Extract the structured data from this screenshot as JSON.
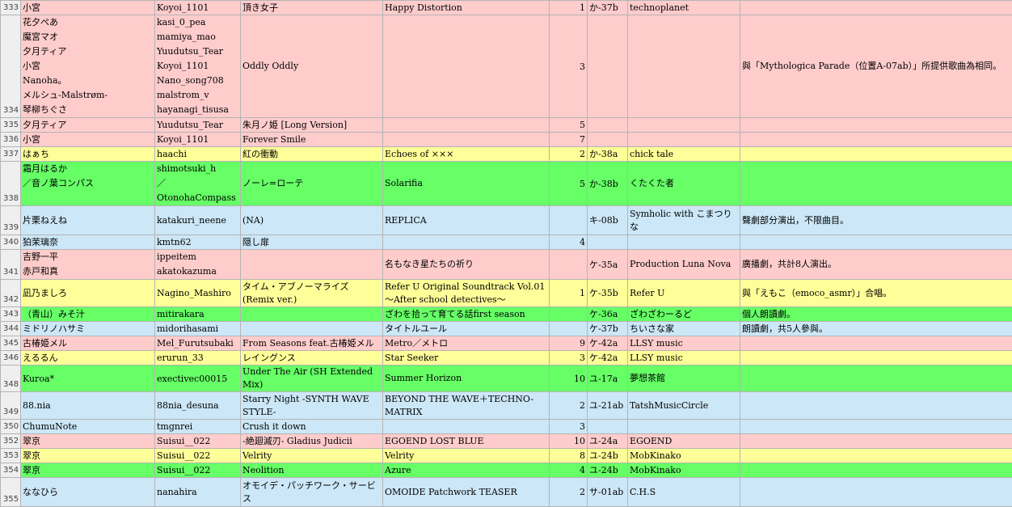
{
  "colors": {
    "pink": "#ffcccc",
    "yellow": "#ffff99",
    "green": "#66ff66",
    "blue": "#cce7f7",
    "rownum_bg": "#efefef",
    "grid_line": "#b4b4b4"
  },
  "rows": [
    {
      "num": "333",
      "color": "pink",
      "h": 17,
      "artist": "小宮",
      "account": "Koyoi_1101",
      "title": "頂き女子",
      "release": "Happy Distortion",
      "count": "1",
      "booth": "か-37b",
      "circle": "technoplanet",
      "note": ""
    },
    {
      "num": "334",
      "color": "pink",
      "h": 127,
      "multi": true,
      "artist": "花夕ぺあ\n魔宮マオ\n夕月ティア\n小宮\nNanoha。\nメルシュ-Malstrøm-\n琴柳ちぐさ",
      "account": "kasi_0_pea\nmamiya_mao\nYuudutsu_Tear\nKoyoi_1101\nNano_song708\nmalstrom_v\nhayanagi_tisusa",
      "title": "Oddly Oddly",
      "release": "",
      "count": "3",
      "booth": "",
      "circle": "",
      "note": "與「Mythologica Parade（位置A-07ab）」所提供歌曲為相同。"
    },
    {
      "num": "335",
      "color": "pink",
      "h": 17,
      "artist": "夕月ティア",
      "account": "Yuudutsu_Tear",
      "title": "朱月ノ姫 [Long Version]",
      "release": "",
      "count": "5",
      "booth": "",
      "circle": "",
      "note": ""
    },
    {
      "num": "336",
      "color": "pink",
      "h": 17,
      "artist": "小宮",
      "account": "Koyoi_1101",
      "title": "Forever Smile",
      "release": "",
      "count": "7",
      "booth": "",
      "circle": "",
      "note": ""
    },
    {
      "num": "337",
      "color": "yellow",
      "h": 17,
      "artist": "はぁち",
      "account": "haachi",
      "title": "紅の衝動",
      "release": "Echoes of ×××",
      "count": "2",
      "booth": "か-38a",
      "circle": "chick tale",
      "note": ""
    },
    {
      "num": "338",
      "color": "green",
      "h": 34,
      "multi": true,
      "artist": "霜月はるか\n／音ノ葉コンパス",
      "account": "shimotsuki_h\n／OtonohaCompass",
      "title": "ノーレ=ローテ",
      "release": "Solarifia",
      "count": "5",
      "booth": "か-38b",
      "circle": "くたくた者",
      "note": ""
    },
    {
      "num": "339",
      "color": "blue",
      "h": 36,
      "artist": "片栗ねえね",
      "account": "katakuri_neene",
      "title": "(NA)",
      "release": "REPLICA",
      "count": "",
      "booth": "キ-08b",
      "circle": "Symholic with こまつりな",
      "note": "聲劇部分演出，不限曲目。"
    },
    {
      "num": "340",
      "color": "blue",
      "h": 17,
      "artist": "狛茉璃奈",
      "account": "kmtn62",
      "title": "隠し扉",
      "release": "",
      "count": "4",
      "booth": "",
      "circle": "",
      "note": ""
    },
    {
      "num": "341",
      "color": "pink",
      "h": 34,
      "multi": true,
      "artist": "吉野一平\n赤戸和真",
      "account": "ippeitem\nakatokazuma",
      "title": "",
      "release": "名もなき星たちの祈り",
      "count": "",
      "booth": "ケ-35a",
      "circle": "Production Luna Nova",
      "note": "廣播劇，共計8人演出。"
    },
    {
      "num": "342",
      "color": "yellow",
      "h": 34,
      "artist": "凪乃ましろ",
      "account": "Nagino_Mashiro",
      "title": "タイム・アブノーマライズ (Remix ver.)",
      "release": "Refer U Original Soundtrack Vol.01 〜After school detectives〜",
      "count": "1",
      "booth": "ケ-35b",
      "circle": "Refer U",
      "note": "與「えもこ（emoco_asmr）」合唱。"
    },
    {
      "num": "343",
      "color": "green",
      "h": 17,
      "artist": "（青山）みそ汁",
      "account": "mitirakara",
      "title": "",
      "release": "ざわを拾って育てる話first season",
      "count": "",
      "booth": "ケ-36a",
      "circle": "ざわざわーるど",
      "note": "個人朗讀劇。"
    },
    {
      "num": "344",
      "color": "blue",
      "h": 17,
      "artist": "ミドリノハサミ",
      "account": "midorihasami",
      "title": "",
      "release": "タイトルユール",
      "count": "",
      "booth": "ケ-37b",
      "circle": "ちいさな家",
      "note": "朗讀劇，共5人參與。"
    },
    {
      "num": "345",
      "color": "pink",
      "h": 17,
      "artist": "古椿姫メル",
      "account": "Mel_Furutsubaki",
      "title": "From Seasons feat.古椿姫メル",
      "release": "Metro／メトロ",
      "count": "9",
      "booth": "ケ-42a",
      "circle": "LLSY music",
      "note": ""
    },
    {
      "num": "346",
      "color": "yellow",
      "h": 17,
      "artist": "えるるん",
      "account": "erurun_33",
      "title": "レイングンス",
      "release": "Star Seeker",
      "count": "3",
      "booth": "ケ-42a",
      "circle": "LLSY music",
      "note": ""
    },
    {
      "num": "348",
      "color": "green",
      "h": 17,
      "artist": "Kuroa*",
      "account": "exectivec00015",
      "title": "Under The Air (SH Extended Mix)",
      "release": "Summer Horizon",
      "count": "10",
      "booth": "ユ-17a",
      "circle": "夢想茶館",
      "note": ""
    },
    {
      "num": "349",
      "color": "blue",
      "h": 34,
      "artist": "88.nia",
      "account": "88nia_desuna",
      "title": "Starry Night -SYNTH WAVE STYLE-",
      "release": "BEYOND THE WAVE＋TECHNO-MATRIX",
      "count": "2",
      "booth": "ユ-21ab",
      "circle": "TatshMusicCircle",
      "note": ""
    },
    {
      "num": "350",
      "color": "blue",
      "h": 17,
      "artist": "ChumuNote",
      "account": "tmgnrei",
      "title": "Crush it down",
      "release": "",
      "count": "3",
      "booth": "",
      "circle": "",
      "note": ""
    },
    {
      "num": "352",
      "color": "pink",
      "h": 17,
      "artist": "翠京",
      "account": "Suisui__022",
      "title": "-絶廻滅刃- Gladius Judicii",
      "release": "EGOEND LOST BLUE",
      "count": "10",
      "booth": "ユ-24a",
      "circle": "EGOEND",
      "note": ""
    },
    {
      "num": "353",
      "color": "yellow",
      "h": 17,
      "artist": "翠京",
      "account": "Suisui__022",
      "title": "Velrity",
      "release": "Velrity",
      "count": "8",
      "booth": "ユ-24b",
      "circle": "MobKinako",
      "note": ""
    },
    {
      "num": "354",
      "color": "green",
      "h": 17,
      "artist": "翠京",
      "account": "Suisui__022",
      "title": "Neolition",
      "release": "Azure",
      "count": "4",
      "booth": "ユ-24b",
      "circle": "MobKinako",
      "note": ""
    },
    {
      "num": "355",
      "color": "blue",
      "h": 36,
      "artist": "ななひら",
      "account": "nanahira",
      "title": "オモイデ・パッチワーク・サービス",
      "release": "OMOIDE Patchwork TEASER",
      "count": "2",
      "booth": "サ-01ab",
      "circle": "C.H.S",
      "note": ""
    }
  ]
}
